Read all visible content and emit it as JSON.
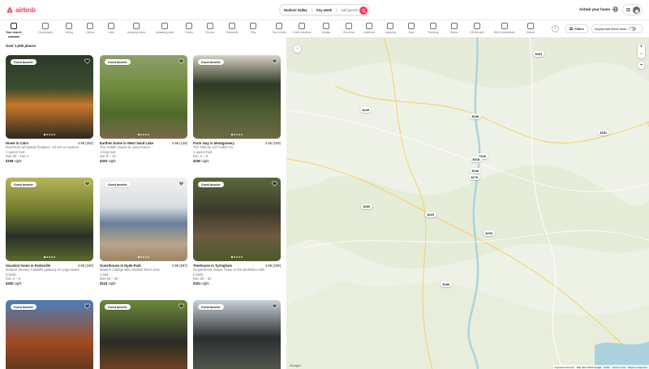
{
  "header": {
    "logo_text": "airbnb",
    "brand_color": "#ff385c",
    "search": {
      "location": "Hudson Valley",
      "dates": "Any week",
      "guests": "Add guests"
    },
    "host_link": "Airbnb your home"
  },
  "categories": [
    {
      "label": "Your search",
      "icon": "search-icon",
      "active": true
    },
    {
      "label": "Countryside",
      "icon": "countryside-icon"
    },
    {
      "label": "Skiing",
      "icon": "skiing-icon"
    },
    {
      "label": "Cabins",
      "icon": "cabin-icon"
    },
    {
      "label": "Lake",
      "icon": "lake-icon"
    },
    {
      "label": "Amazing views",
      "icon": "views-icon"
    },
    {
      "label": "Amazing pools",
      "icon": "pool-icon"
    },
    {
      "label": "Farms",
      "icon": "farm-icon"
    },
    {
      "label": "Rooms",
      "icon": "room-icon"
    },
    {
      "label": "Vineyards",
      "icon": "vineyard-icon"
    },
    {
      "label": "Play",
      "icon": "play-icon"
    },
    {
      "label": "Tiny homes",
      "icon": "tiny-home-icon"
    },
    {
      "label": "Chef's kitchens",
      "icon": "kitchen-icon"
    },
    {
      "label": "Design",
      "icon": "design-icon"
    },
    {
      "label": "Ski-in/out",
      "icon": "ski-in-out-icon"
    },
    {
      "label": "Lakefront",
      "icon": "lakefront-icon"
    },
    {
      "label": "Camping",
      "icon": "camping-icon"
    },
    {
      "label": "New",
      "icon": "new-icon"
    },
    {
      "label": "Trending",
      "icon": "trending-icon"
    },
    {
      "label": "Barns",
      "icon": "barn-icon"
    },
    {
      "label": "Off-the-grid",
      "icon": "off-grid-icon"
    },
    {
      "label": "Bed & breakfasts",
      "icon": "bnb-icon"
    },
    {
      "label": "Desert",
      "icon": "desert-icon"
    },
    {
      "label": "",
      "icon": "more-icon"
    }
  ],
  "filters_label": "Filters",
  "taxes_label": "Display total before taxes",
  "places_count": "Over 1,000 places",
  "listings": [
    {
      "badge": "Guest favorite",
      "title": "Home in Cairo",
      "rating": "4.99 (252)",
      "desc": "Riverfront w/Outside fireplace, 20 min to Hudson",
      "beds": "1 queen bed",
      "dates": "Nov 26 – Dec 1",
      "price": "$198",
      "per": " night"
    },
    {
      "badge": "Guest favorite",
      "title": "Earthen home in West Sand Lake",
      "rating": "4.98 (129)",
      "desc": "The Hobbit House at Juna Farms",
      "beds": "1 king bed",
      "dates": "Jan 8 – 13",
      "price": "$303",
      "per": " night"
    },
    {
      "badge": "Guest favorite",
      "title": "Farm stay in Montgomery",
      "rating": "4.96 (109)",
      "desc": "The Trek by 127 Cabin Co.",
      "beds": "1 queen bed",
      "dates": "Dec 3 – 8",
      "price": "$180",
      "per": " night"
    },
    {
      "badge": "Guest favorite",
      "title": "Vacation home in Parksville",
      "rating": "4.96 (100)",
      "desc": "Modern dreamy Catskills getaway w/ yoga studio",
      "beds": "3 beds",
      "dates": "Dec 3 – 8",
      "price": "$300",
      "per": " night"
    },
    {
      "badge": "Guest favorite",
      "title": "Guesthouse in Hyde Park",
      "rating": "4.99 (597)",
      "desc": "Modern cottage with Hudson River view",
      "beds": "1 bed",
      "dates": "Nov 25 – 30",
      "price": "$233",
      "per": " night"
    },
    {
      "badge": "Guest favorite",
      "title": "Treehouse in Tyringham",
      "rating": "4.99 (198)",
      "desc": "Gingerbread House Tower in the Berkshire Hills",
      "beds": "2 beds",
      "dates": "Nov 25 – 30",
      "price": "$251",
      "per": " night"
    },
    {
      "badge": "Guest favorite"
    },
    {
      "badge": "Guest favorite"
    },
    {
      "badge": "Guest favorite"
    }
  ],
  "map": {
    "pins": [
      "$303",
      "$249",
      "$198",
      "$251",
      "$316",
      "$318",
      "$248",
      "$176",
      "$300",
      "$423",
      "$233",
      "$180"
    ],
    "footer": [
      "Keyboard shortcuts",
      "Map data ©2023 Google",
      "10 km",
      "Terms of Use",
      "Report a map error"
    ],
    "logo": "Google"
  }
}
